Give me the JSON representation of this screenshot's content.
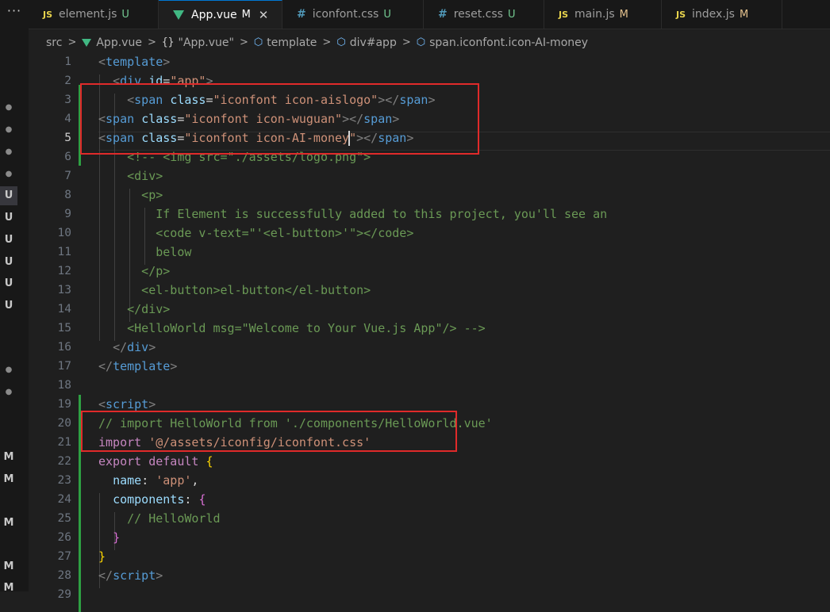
{
  "activity": {
    "more_label": "···",
    "badges": [
      "●",
      "●",
      "●",
      "●",
      "U",
      "U",
      "U",
      "U",
      "U",
      "U",
      "●",
      "●",
      "M",
      "M",
      "M",
      "M",
      "M"
    ]
  },
  "tabs": [
    {
      "icon": "JS",
      "label": "element.js",
      "status": "U"
    },
    {
      "icon": "vue",
      "label": "App.vue",
      "status": "M",
      "close": "✕"
    },
    {
      "icon": "#",
      "label": "iconfont.css",
      "status": "U"
    },
    {
      "icon": "#",
      "label": "reset.css",
      "status": "U"
    },
    {
      "icon": "JS",
      "label": "main.js",
      "status": "M"
    },
    {
      "icon": "JS",
      "label": "index.js",
      "status": "M"
    }
  ],
  "breadcrumb": {
    "separator": ">",
    "items": [
      "src",
      "App.vue",
      "\"App.vue\"",
      "template",
      "div#app",
      "span.iconfont.icon-AI-money"
    ],
    "braces": "{}"
  },
  "editor": {
    "line_numbers": [
      "1",
      "2",
      "3",
      "4",
      "5",
      "6",
      "7",
      "8",
      "9",
      "10",
      "11",
      "12",
      "13",
      "14",
      "15",
      "16",
      "17",
      "18",
      "19",
      "20",
      "21",
      "22",
      "23",
      "24",
      "25",
      "26",
      "27",
      "28",
      "29"
    ],
    "active_line": "5",
    "lines": [
      [
        [
          "t-bracket",
          "<"
        ],
        [
          "t-tag",
          "template"
        ],
        [
          "t-bracket",
          ">"
        ]
      ],
      [
        [
          "t-plain",
          "  "
        ],
        [
          "t-bracket",
          "<"
        ],
        [
          "t-tag",
          "div"
        ],
        [
          "t-plain",
          " "
        ],
        [
          "t-attr",
          "id"
        ],
        [
          "t-plain",
          "="
        ],
        [
          "t-str",
          "\"app\""
        ],
        [
          "t-bracket",
          ">"
        ]
      ],
      [
        [
          "t-plain",
          "    "
        ],
        [
          "t-bracket",
          "<"
        ],
        [
          "t-tag",
          "span"
        ],
        [
          "t-plain",
          " "
        ],
        [
          "t-attr",
          "class"
        ],
        [
          "t-plain",
          "="
        ],
        [
          "t-str",
          "\"iconfont icon-aislogo\""
        ],
        [
          "t-bracket",
          "></"
        ],
        [
          "t-tag",
          "span"
        ],
        [
          "t-bracket",
          ">"
        ]
      ],
      [
        [
          "t-bracket",
          "<"
        ],
        [
          "t-tag",
          "span"
        ],
        [
          "t-plain",
          " "
        ],
        [
          "t-attr",
          "class"
        ],
        [
          "t-plain",
          "="
        ],
        [
          "t-str",
          "\"iconfont icon-wuguan\""
        ],
        [
          "t-bracket",
          "></"
        ],
        [
          "t-tag",
          "span"
        ],
        [
          "t-bracket",
          ">"
        ]
      ],
      [
        [
          "t-bracket",
          "<"
        ],
        [
          "t-tag",
          "span"
        ],
        [
          "t-plain",
          " "
        ],
        [
          "t-attr",
          "class"
        ],
        [
          "t-plain",
          "="
        ],
        [
          "t-str",
          "\"iconfont icon-AI-money"
        ],
        [
          "caret",
          ""
        ],
        [
          "t-str",
          "\""
        ],
        [
          "t-bracket",
          "></"
        ],
        [
          "t-tag",
          "span"
        ],
        [
          "t-bracket",
          ">"
        ]
      ],
      [
        [
          "t-comment",
          "    <!-- <img src=\"./assets/logo.png\">"
        ]
      ],
      [
        [
          "t-comment",
          "    <div>"
        ]
      ],
      [
        [
          "t-comment",
          "      <p>"
        ]
      ],
      [
        [
          "t-comment",
          "        If Element is successfully added to this project, you'll see an"
        ]
      ],
      [
        [
          "t-comment",
          "        <code v-text=\"'<el-button>'\"></code>"
        ]
      ],
      [
        [
          "t-comment",
          "        below"
        ]
      ],
      [
        [
          "t-comment",
          "      </p>"
        ]
      ],
      [
        [
          "t-comment",
          "      <el-button>el-button</el-button>"
        ]
      ],
      [
        [
          "t-comment",
          "    </div>"
        ]
      ],
      [
        [
          "t-comment",
          "    <HelloWorld msg=\"Welcome to Your Vue.js App\"/> -->"
        ]
      ],
      [
        [
          "t-plain",
          "  "
        ],
        [
          "t-bracket",
          "</"
        ],
        [
          "t-tag",
          "div"
        ],
        [
          "t-bracket",
          ">"
        ]
      ],
      [
        [
          "t-bracket",
          "</"
        ],
        [
          "t-tag",
          "template"
        ],
        [
          "t-bracket",
          ">"
        ]
      ],
      [],
      [
        [
          "t-bracket",
          "<"
        ],
        [
          "t-tag",
          "script"
        ],
        [
          "t-bracket",
          ">"
        ]
      ],
      [
        [
          "t-comment",
          "// import HelloWorld from './components/HelloWorld.vue'"
        ]
      ],
      [
        [
          "t-kw",
          "import"
        ],
        [
          "t-plain",
          " "
        ],
        [
          "t-str",
          "'@/assets/iconfig/iconfont.css'"
        ]
      ],
      [
        [
          "t-kw",
          "export"
        ],
        [
          "t-plain",
          " "
        ],
        [
          "t-kw",
          "default"
        ],
        [
          "t-plain",
          " "
        ],
        [
          "t-b1",
          "{"
        ]
      ],
      [
        [
          "t-plain",
          "  "
        ],
        [
          "t-prop",
          "name"
        ],
        [
          "t-plain",
          ": "
        ],
        [
          "t-str",
          "'app'"
        ],
        [
          "t-plain",
          ","
        ]
      ],
      [
        [
          "t-plain",
          "  "
        ],
        [
          "t-prop",
          "components"
        ],
        [
          "t-plain",
          ": "
        ],
        [
          "t-b2",
          "{"
        ]
      ],
      [
        [
          "t-comment",
          "    // HelloWorld"
        ]
      ],
      [
        [
          "t-plain",
          "  "
        ],
        [
          "t-b2",
          "}"
        ]
      ],
      [
        [
          "t-b1",
          "}"
        ]
      ],
      [
        [
          "t-bracket",
          "</"
        ],
        [
          "t-tag",
          "script"
        ],
        [
          "t-bracket",
          ">"
        ]
      ],
      []
    ]
  }
}
